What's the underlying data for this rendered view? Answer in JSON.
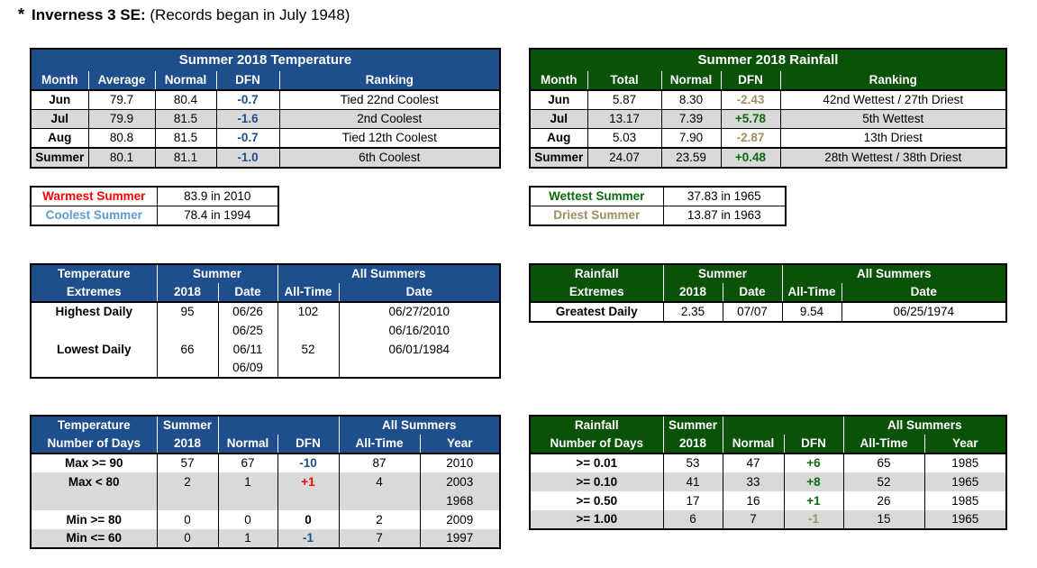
{
  "header": {
    "star": "*",
    "station": "Inverness 3 SE:",
    "note": "(Records began in July 1948)"
  },
  "temp_summary": {
    "title": "Summer 2018 Temperature",
    "columns": [
      "Month",
      "Average",
      "Normal",
      "DFN",
      "Ranking"
    ],
    "rows": [
      {
        "month": "Jun",
        "average": "79.7",
        "normal": "80.4",
        "dfn": "-0.7",
        "ranking": "Tied 22nd Coolest"
      },
      {
        "month": "Jul",
        "average": "79.9",
        "normal": "81.5",
        "dfn": "-1.6",
        "ranking": "2nd Coolest"
      },
      {
        "month": "Aug",
        "average": "80.8",
        "normal": "81.5",
        "dfn": "-0.7",
        "ranking": "Tied 12th Coolest"
      },
      {
        "month": "Summer",
        "average": "80.1",
        "normal": "81.1",
        "dfn": "-1.0",
        "ranking": "6th Coolest"
      }
    ]
  },
  "rain_summary": {
    "title": "Summer 2018 Rainfall",
    "columns": [
      "Month",
      "Total",
      "Normal",
      "DFN",
      "Ranking"
    ],
    "rows": [
      {
        "month": "Jun",
        "total": "5.87",
        "normal": "8.30",
        "dfn": "-2.43",
        "ranking": "42nd Wettest / 27th Driest"
      },
      {
        "month": "Jul",
        "total": "13.17",
        "normal": "7.39",
        "dfn": "+5.78",
        "ranking": "5th Wettest"
      },
      {
        "month": "Aug",
        "total": "5.03",
        "normal": "7.90",
        "dfn": "-2.87",
        "ranking": "13th Driest"
      },
      {
        "month": "Summer",
        "total": "24.07",
        "normal": "23.59",
        "dfn": "+0.48",
        "ranking": "28th Wettest / 38th Driest"
      }
    ]
  },
  "temp_records": {
    "warmest_label": "Warmest Summer",
    "warmest_value": "83.9 in 2010",
    "coolest_label": "Coolest Summer",
    "coolest_value": "78.4 in 1994"
  },
  "rain_records": {
    "wettest_label": "Wettest Summer",
    "wettest_value": "37.83 in 1965",
    "driest_label": "Driest Summer",
    "driest_value": "13.87 in 1963"
  },
  "temp_extremes": {
    "h1": "Temperature",
    "h2": "Extremes",
    "summer": "Summer",
    "all_summers": "All Summers",
    "c2018": "2018",
    "cdate": "Date",
    "call_time": "All-Time",
    "cdate2": "Date",
    "highest": {
      "label": "Highest Daily",
      "value": "95",
      "dates": [
        "06/26",
        "06/25"
      ],
      "all_time": "102",
      "all_time_dates": [
        "06/27/2010",
        "06/16/2010"
      ]
    },
    "lowest": {
      "label": "Lowest Daily",
      "value": "66",
      "dates": [
        "06/11",
        "06/09"
      ],
      "all_time": "52",
      "all_time_dates": [
        "06/01/1984"
      ]
    }
  },
  "rain_extremes": {
    "h1": "Rainfall",
    "h2": "Extremes",
    "summer": "Summer",
    "all_summers": "All Summers",
    "c2018": "2018",
    "cdate": "Date",
    "call_time": "All-Time",
    "cdate2": "Date",
    "greatest": {
      "label": "Greatest Daily",
      "value": "2.35",
      "date": "07/07",
      "all_time": "9.54",
      "all_time_date": "06/25/1974"
    }
  },
  "temp_days": {
    "h1": "Temperature",
    "h2": "Number of Days",
    "summer": "Summer",
    "c2018": "2018",
    "normal": "Normal",
    "dfn": "DFN",
    "all_summers": "All Summers",
    "all_time": "All-Time",
    "year": "Year",
    "rows": [
      {
        "label": "Max >= 90",
        "v2018": "57",
        "normal": "67",
        "dfn": "-10",
        "all_time": "87",
        "years": [
          "2010"
        ]
      },
      {
        "label": "Max < 80",
        "v2018": "2",
        "normal": "1",
        "dfn": "+1",
        "all_time": "4",
        "years": [
          "2003",
          "1968"
        ]
      },
      {
        "label": "Min >= 80",
        "v2018": "0",
        "normal": "0",
        "dfn": "0",
        "all_time": "2",
        "years": [
          "2009"
        ]
      },
      {
        "label": "Min <= 60",
        "v2018": "0",
        "normal": "1",
        "dfn": "-1",
        "all_time": "7",
        "years": [
          "1997"
        ]
      }
    ]
  },
  "rain_days": {
    "h1": "Rainfall",
    "h2": "Number of Days",
    "summer": "Summer",
    "c2018": "2018",
    "normal": "Normal",
    "dfn": "DFN",
    "all_summers": "All Summers",
    "all_time": "All-Time",
    "year": "Year",
    "rows": [
      {
        "label": ">= 0.01",
        "v2018": "53",
        "normal": "47",
        "dfn": "+6",
        "all_time": "65",
        "year": "1985"
      },
      {
        "label": ">= 0.10",
        "v2018": "41",
        "normal": "33",
        "dfn": "+8",
        "all_time": "52",
        "year": "1965"
      },
      {
        "label": ">= 0.50",
        "v2018": "17",
        "normal": "16",
        "dfn": "+1",
        "all_time": "26",
        "year": "1985"
      },
      {
        "label": ">= 1.00",
        "v2018": "6",
        "normal": "7",
        "dfn": "-1",
        "all_time": "15",
        "year": "1965"
      }
    ]
  },
  "colors": {
    "temp_header": "#1f4e8c",
    "rain_header": "#0b5209",
    "warm_red": "#ff0000",
    "cool_blue": "#5b9bd5",
    "wet_green": "#0b6b0b",
    "dry_tan": "#a08f62",
    "alt_row": "#d9d9d9"
  }
}
